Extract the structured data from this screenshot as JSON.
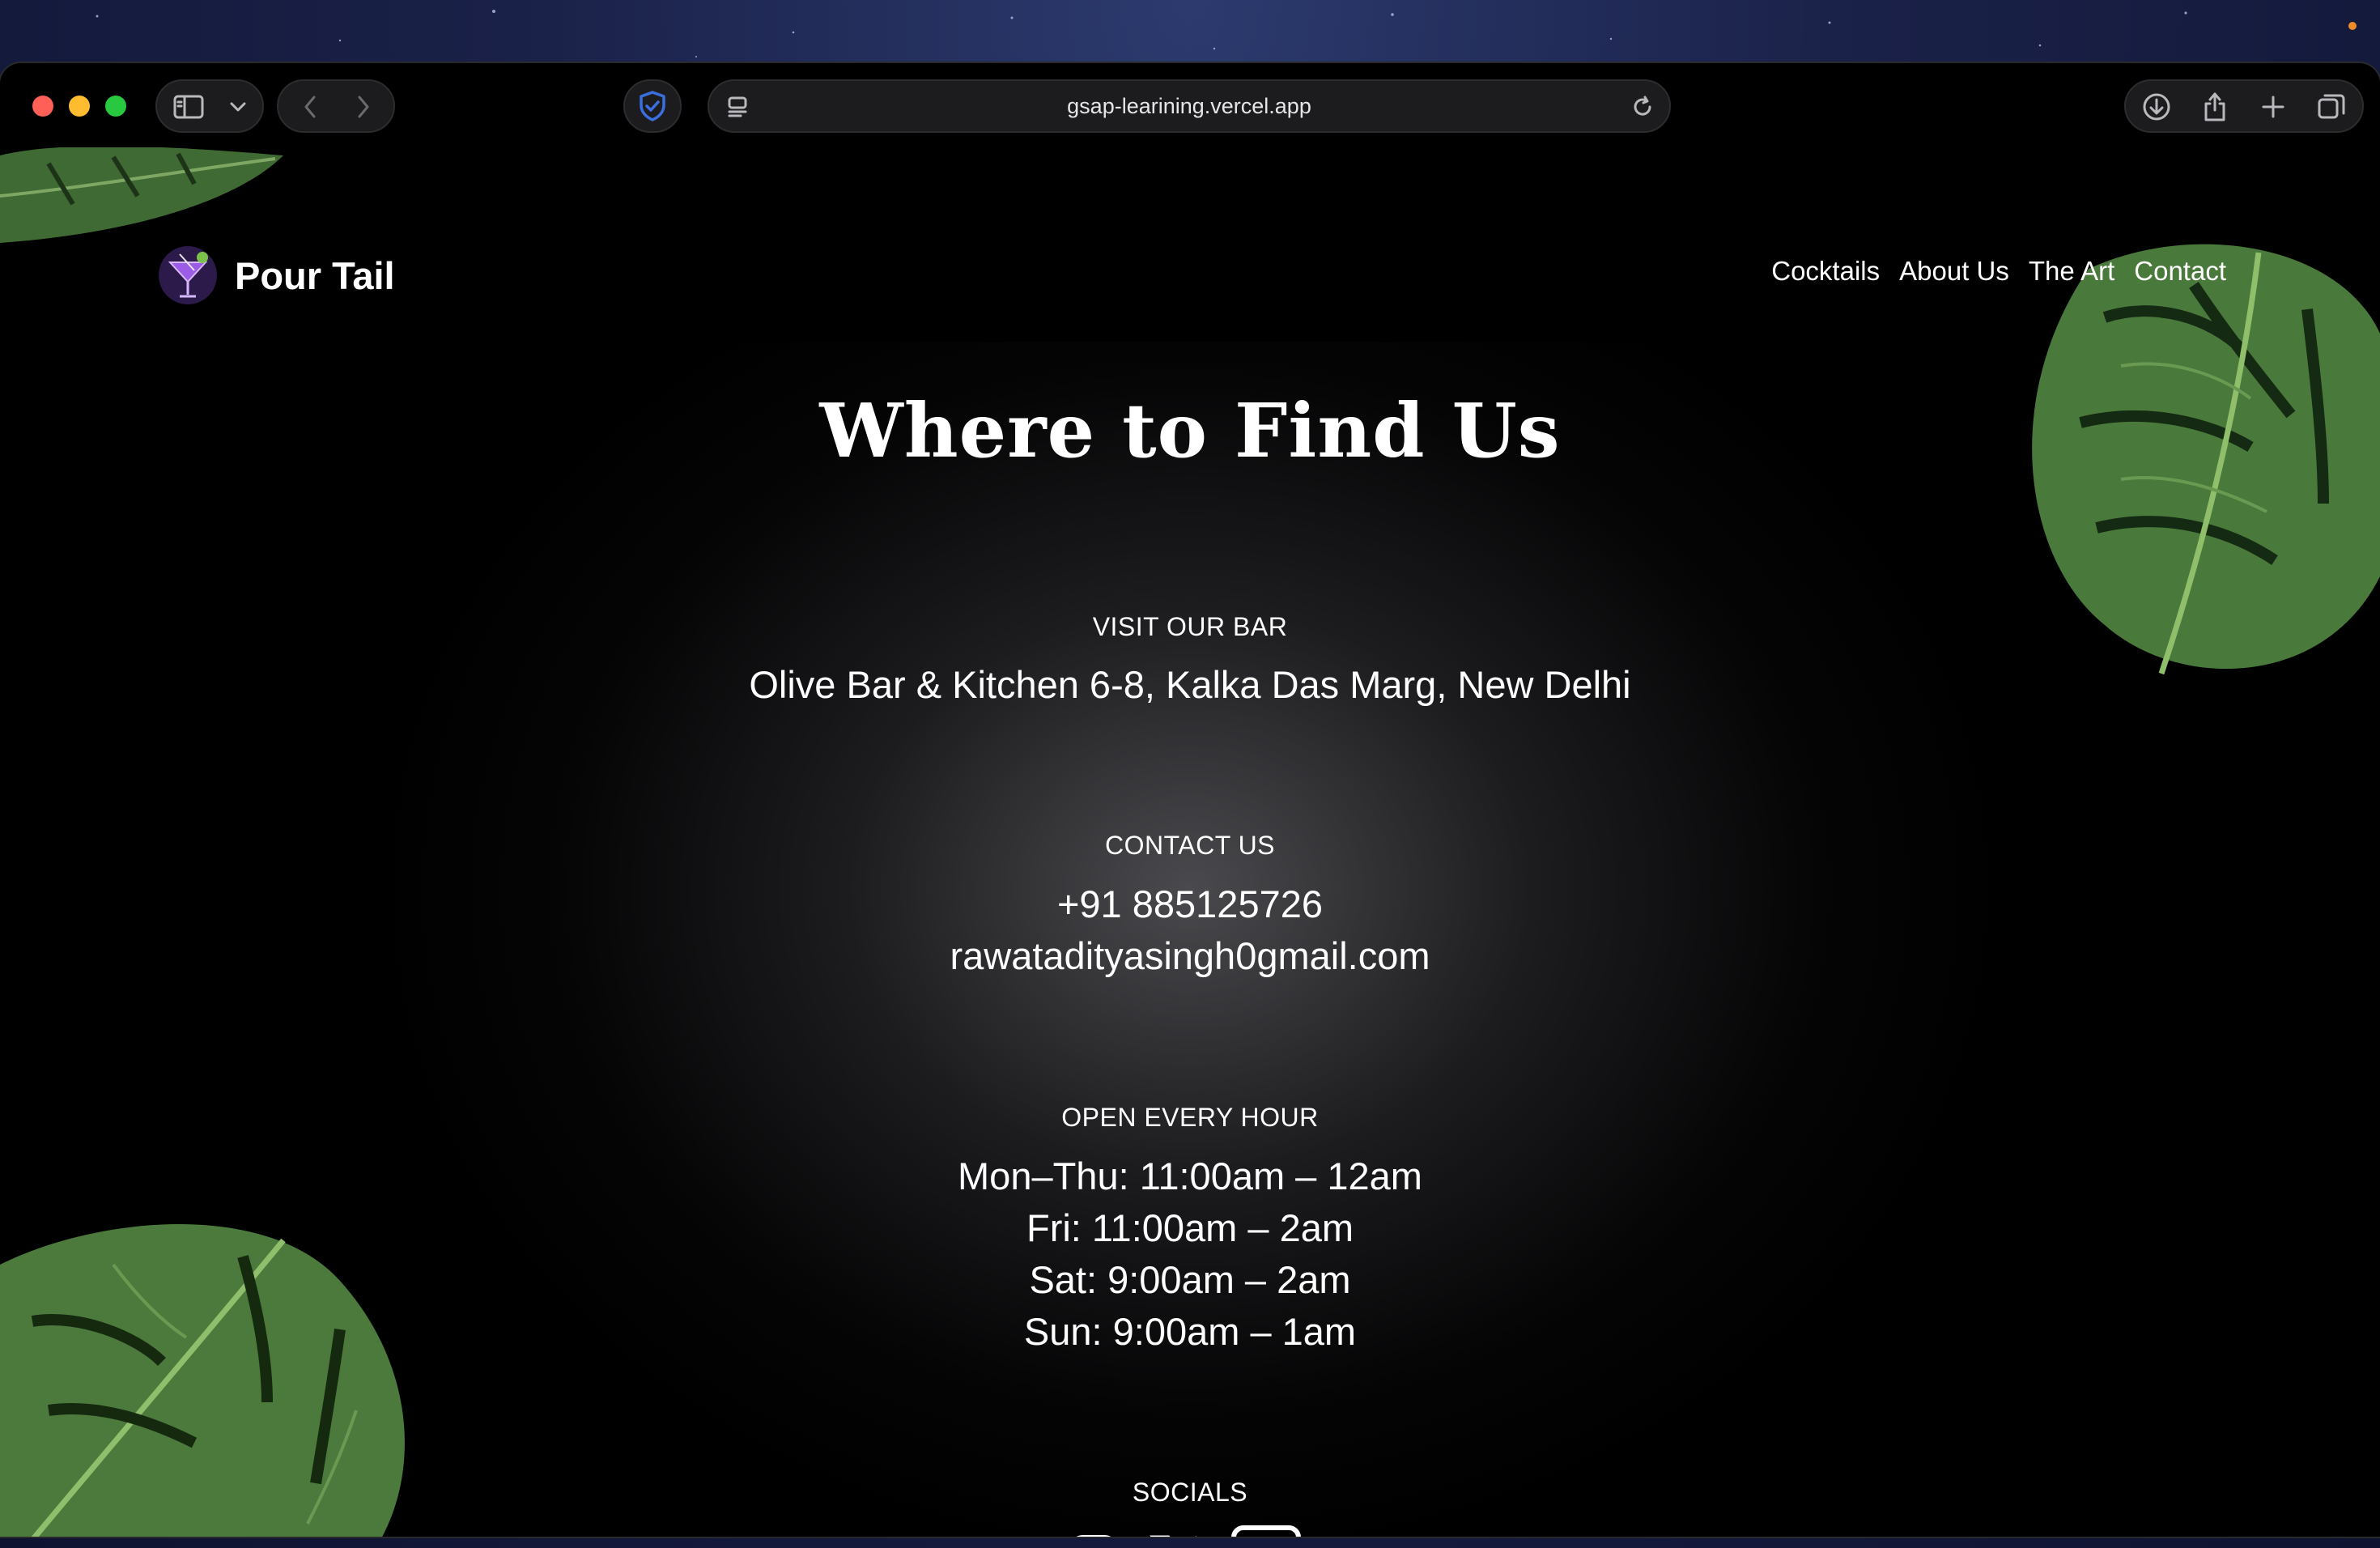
{
  "browser": {
    "url": "gsap-learining.vercel.app",
    "icons": [
      "sidebar-icon",
      "chevron-down-icon",
      "back-icon",
      "forward-icon",
      "shield-icon",
      "reader-icon",
      "reload-icon",
      "download-icon",
      "share-icon",
      "new-tab-icon",
      "tabs-overview-icon"
    ]
  },
  "nav": {
    "brand": "Pour Tail",
    "links": [
      "Cocktails",
      "About Us",
      "The Art",
      "Contact"
    ]
  },
  "main": {
    "title": "Where to Find Us",
    "visit": {
      "label": "VISIT OUR BAR",
      "address": "Olive Bar & Kitchen 6-8, Kalka Das Marg, New Delhi"
    },
    "contact": {
      "label": "CONTACT US",
      "phone": "+91 885125726",
      "email": "rawatadityasingh0gmail.com"
    },
    "hours": {
      "label": "OPEN EVERY HOUR",
      "lines": [
        "Mon–Thu: 11:00am – 12am",
        "Fri: 11:00am – 2am",
        "Sat: 9:00am – 2am",
        "Sun: 9:00am – 1am"
      ]
    },
    "socials": {
      "label": "SOCIALS",
      "icons": [
        "instagram-icon",
        "x-icon",
        "linkedin-icon"
      ]
    }
  },
  "colors": {
    "page_bg": "#000000",
    "text": "#ffffff",
    "leaf": "#4f7a3c",
    "shield": "#3b6fe0"
  }
}
